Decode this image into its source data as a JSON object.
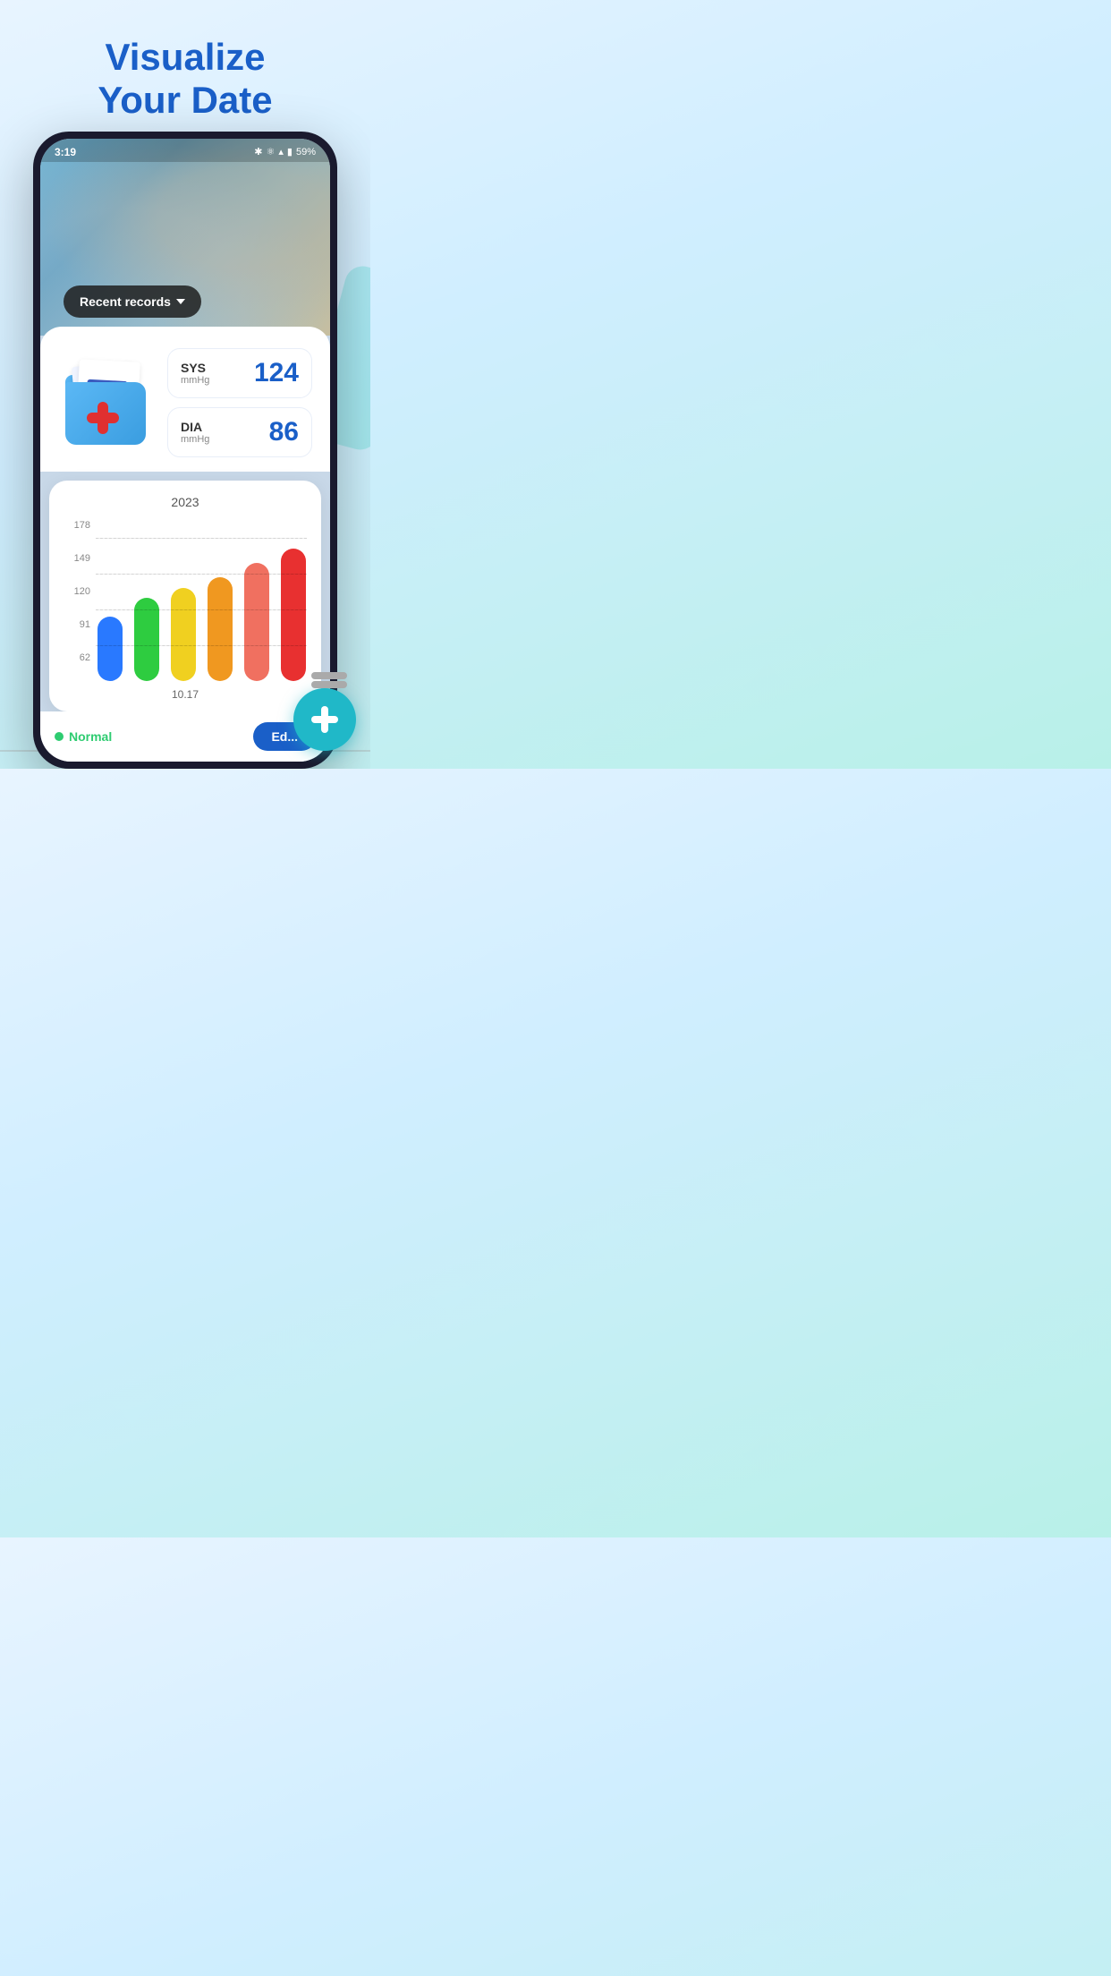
{
  "hero": {
    "title_line1": "Visualize",
    "title_line2": "Your Date"
  },
  "status_bar": {
    "time": "3:19",
    "battery": "59%",
    "icons": [
      "bluetooth",
      "vibrate",
      "wifi",
      "signal",
      "battery"
    ]
  },
  "recent_records": {
    "label": "Recent records",
    "chevron": "▾"
  },
  "stats": {
    "sys": {
      "label": "SYS",
      "unit": "mmHg",
      "value": "124"
    },
    "dia": {
      "label": "DIA",
      "unit": "mmHg",
      "value": "86"
    }
  },
  "chart": {
    "year": "2023",
    "y_labels": [
      "178",
      "149",
      "120",
      "91",
      "62"
    ],
    "x_label": "10.17",
    "bars": [
      {
        "color": "#2979ff",
        "height_pct": 45
      },
      {
        "color": "#2ecc40",
        "height_pct": 58
      },
      {
        "color": "#f0d020",
        "height_pct": 65
      },
      {
        "color": "#f09820",
        "height_pct": 72
      },
      {
        "color": "#f07060",
        "height_pct": 82
      },
      {
        "color": "#e83030",
        "height_pct": 92
      }
    ]
  },
  "bottom": {
    "normal_label": "Normal",
    "edit_label": "Ed..."
  },
  "fab": {
    "label": "add"
  }
}
